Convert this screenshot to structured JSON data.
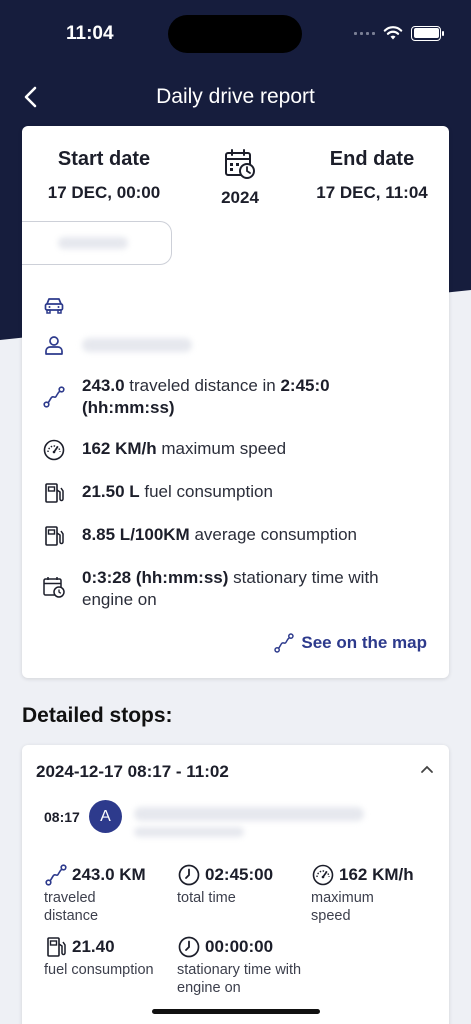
{
  "status_bar": {
    "time": "11:04"
  },
  "nav": {
    "title": "Daily drive report"
  },
  "dates": {
    "start_label": "Start date",
    "start_value": "17 DEC, 00:00",
    "year": "2024",
    "end_label": "End date",
    "end_value": "17 DEC, 11:04"
  },
  "summary": {
    "distance_value": "243.0",
    "distance_text": " traveled distance in ",
    "distance_time": "2:45:0",
    "distance_unit": "(hh:mm:ss)",
    "speed_value": "162 KM/h",
    "speed_text": " maximum speed",
    "fuel_value": "21.50 L",
    "fuel_text": " fuel consumption",
    "avg_value": "8.85 L/100KM",
    "avg_text": " average consumption",
    "stationary_value": "0:3:28 (hh:mm:ss)",
    "stationary_text": " stationary time with engine on",
    "map_link": "See on the map"
  },
  "stops": {
    "section_title": "Detailed stops:",
    "items": [
      {
        "range": "2024-12-17 08:17 - 11:02",
        "start_time": "08:17",
        "marker": "A",
        "distance_value": "243.0 KM",
        "distance_label": "traveled distance",
        "total_time_value": "02:45:00",
        "total_time_label": "total time",
        "max_speed_value": "162 KM/h",
        "max_speed_label": "maximum speed",
        "fuel_value": "21.40",
        "fuel_label": "fuel consumption",
        "stationary_value": "00:00:00",
        "stationary_label": "stationary time with engine on"
      }
    ]
  },
  "colors": {
    "header": "#161d3d",
    "accent": "#2d3a8c",
    "background": "#eef0f5"
  },
  "icons": [
    "back-arrow-icon",
    "calendar-clock-icon",
    "car-icon",
    "person-icon",
    "route-icon",
    "speedometer-icon",
    "fuel-pump-icon",
    "chevron-up-icon",
    "clock-icon"
  ]
}
